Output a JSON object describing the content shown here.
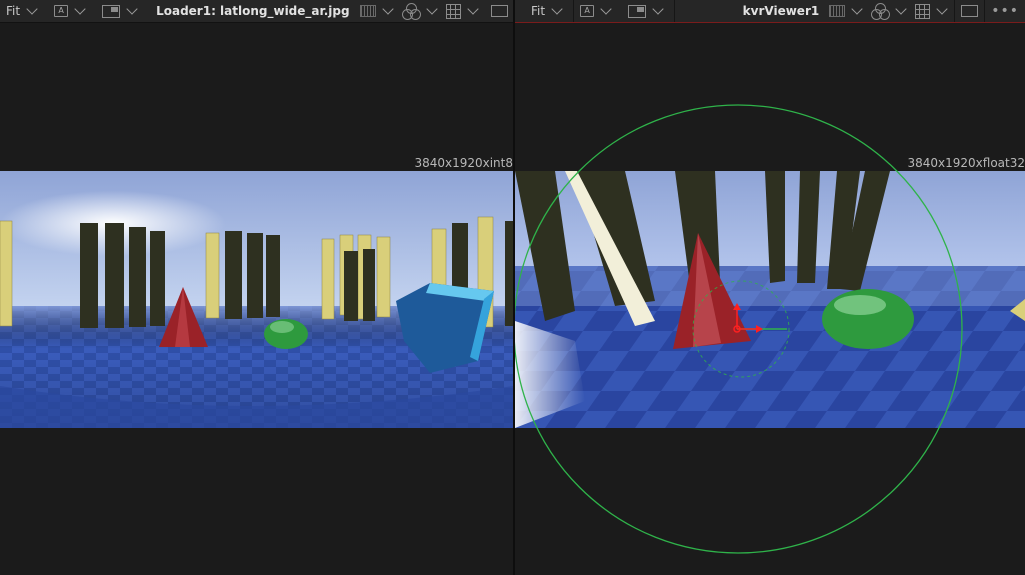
{
  "left_viewer": {
    "fit_label": "Fit",
    "a_label": "A",
    "title": "Loader1: latlong_wide_ar.jpg",
    "resolution": "3840x1920xint8"
  },
  "right_viewer": {
    "fit_label": "Fit",
    "a_label": "A",
    "title": "kvrViewer1",
    "resolution": "3840x1920xfloat32",
    "more_label": "•••"
  },
  "colors": {
    "background": "#1b1b1b",
    "toolbar": "#262626",
    "active_border": "#7a1c1c",
    "sky_top": "#8fa6d8",
    "floor_blue": "#2a4aa0",
    "guide_green": "#2fb34a"
  },
  "icons": [
    "chevron-down-icon",
    "channel-a-icon",
    "window-icon",
    "checker-icon",
    "color-wheel-icon",
    "grid-icon",
    "rect-icon",
    "more-icon"
  ]
}
